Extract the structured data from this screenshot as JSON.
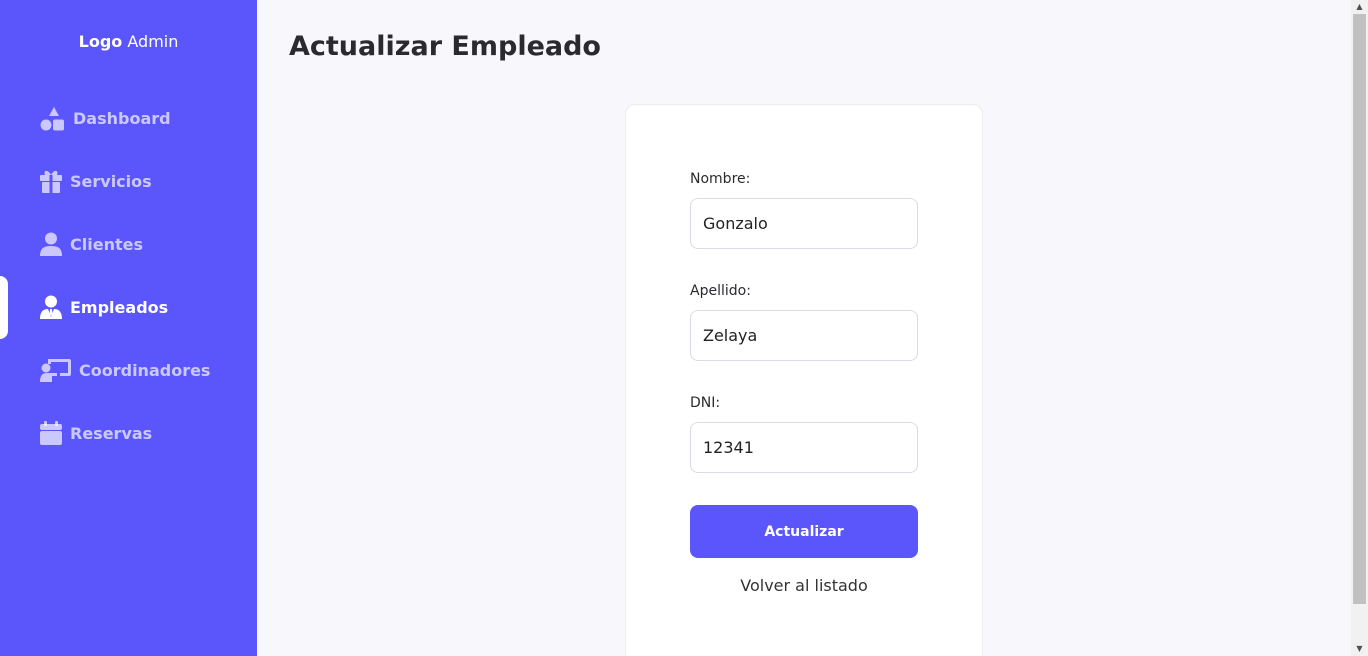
{
  "sidebar": {
    "logo_bold": "Logo",
    "logo_rest": " Admin",
    "items": [
      {
        "label": "Dashboard",
        "icon": "shapes-icon"
      },
      {
        "label": "Servicios",
        "icon": "gift-icon"
      },
      {
        "label": "Clientes",
        "icon": "user-icon"
      },
      {
        "label": "Empleados",
        "icon": "user-tie-icon",
        "active": true
      },
      {
        "label": "Coordinadores",
        "icon": "chalkboard-user-icon"
      },
      {
        "label": "Reservas",
        "icon": "calendar-icon"
      }
    ]
  },
  "main": {
    "title": "Actualizar Empleado"
  },
  "form": {
    "nombre_label": "Nombre:",
    "nombre_value": "Gonzalo",
    "apellido_label": "Apellido:",
    "apellido_value": "Zelaya",
    "dni_label": "DNI:",
    "dni_value": "12341",
    "submit_label": "Actualizar",
    "back_link": "Volver al listado"
  },
  "colors": {
    "accent": "#5a56fb",
    "background": "#f8f8fc",
    "card": "#ffffff"
  }
}
